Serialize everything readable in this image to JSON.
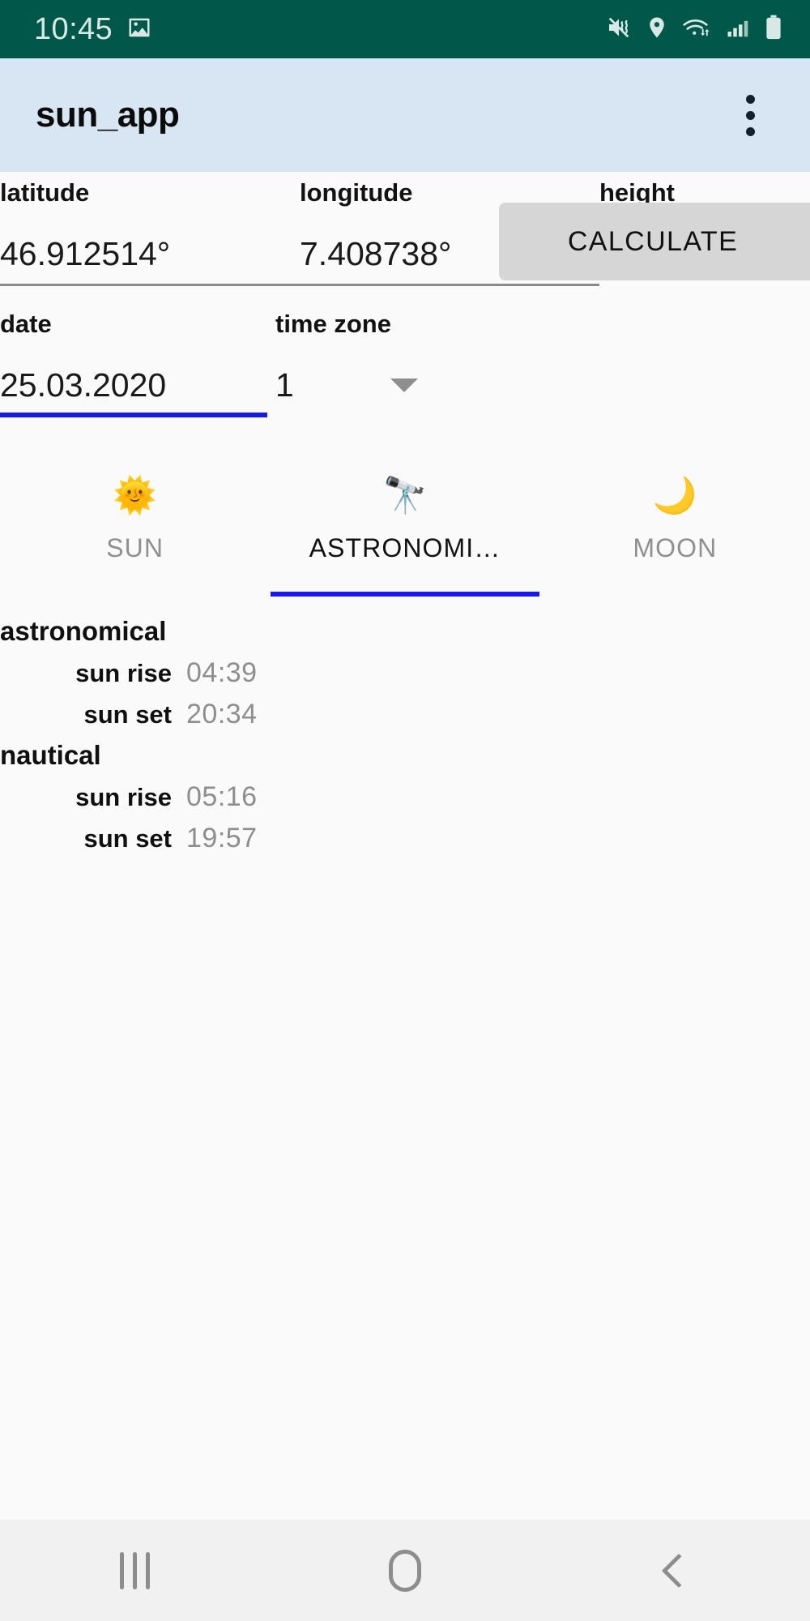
{
  "status_bar": {
    "time": "10:45",
    "background_color": "#00574A",
    "icons": [
      "image-notification-icon",
      "mute-vibrate-icon",
      "location-pin-icon",
      "wifi-icon",
      "cellular-signal-icon",
      "battery-icon"
    ]
  },
  "app_bar": {
    "title": "sun_app",
    "background_color": "#D8E5F3",
    "overflow_menu_label": "More options"
  },
  "form": {
    "fields": [
      {
        "label": "latitude",
        "value": "46.912514°",
        "focused": false
      },
      {
        "label": "longitude",
        "value": "7.408738°",
        "focused": false
      },
      {
        "label": "height",
        "value": "",
        "focused": false
      },
      {
        "label": "date",
        "value": "25.03.2020",
        "focused": true
      },
      {
        "label": "time zone",
        "value": "1",
        "focused": false
      }
    ],
    "time_zone_options": [
      "1"
    ],
    "calculate_label": "CALCULATE",
    "focus_accent_color": "#1A1AE6",
    "button_color": "#D6D6D6"
  },
  "tabs": {
    "active_index": 1,
    "accent_color": "#1A1AE6",
    "items": [
      {
        "label": "SUN",
        "icon": "🌞",
        "icon_name": "sun-icon"
      },
      {
        "label": "ASTRONOMI…",
        "icon": "🔭",
        "icon_name": "telescope-icon"
      },
      {
        "label": "MOON",
        "icon": "🌙",
        "icon_name": "moon-icon"
      }
    ]
  },
  "results": {
    "groups": [
      {
        "title": "astronomical",
        "rows": [
          {
            "key": "sun rise",
            "value": "04:39"
          },
          {
            "key": "sun set",
            "value": "20:34"
          }
        ]
      },
      {
        "title": "nautical",
        "rows": [
          {
            "key": "sun rise",
            "value": "05:16"
          },
          {
            "key": "sun set",
            "value": "19:57"
          }
        ]
      }
    ]
  },
  "nav_bar": {
    "buttons": [
      {
        "name": "recents",
        "label": "Recents"
      },
      {
        "name": "home",
        "label": "Home"
      },
      {
        "name": "back",
        "label": "Back"
      }
    ]
  }
}
